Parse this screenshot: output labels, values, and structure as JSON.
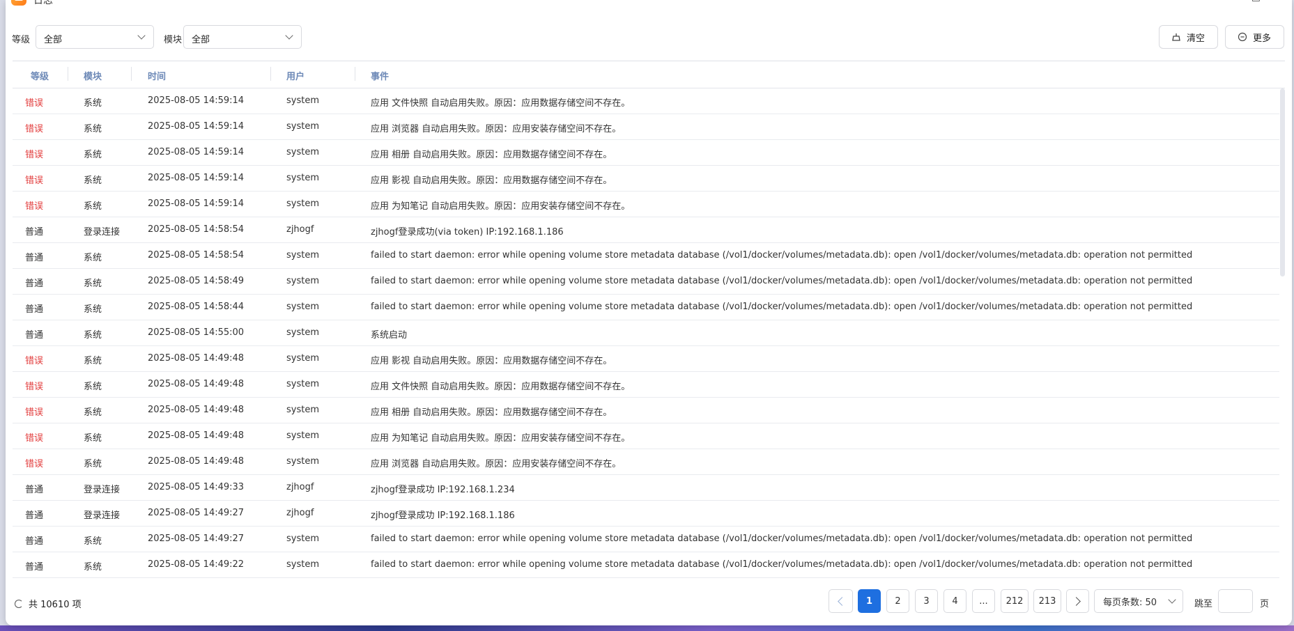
{
  "window": {
    "title": "日志"
  },
  "filters": {
    "level_label": "等级",
    "level_value": "全部",
    "module_label": "模块",
    "module_value": "全部"
  },
  "toolbar": {
    "clear_label": "清空",
    "more_label": "更多"
  },
  "table": {
    "columns": [
      "等级",
      "模块",
      "时间",
      "用户",
      "事件"
    ],
    "rows": [
      {
        "level": "错误",
        "module": "系统",
        "time": "2025-08-05 14:59:14",
        "user": "system",
        "event": "应用 文件快照 自动启用失败。原因：应用数据存储空间不存在。"
      },
      {
        "level": "错误",
        "module": "系统",
        "time": "2025-08-05 14:59:14",
        "user": "system",
        "event": "应用 浏览器 自动启用失败。原因：应用安装存储空间不存在。"
      },
      {
        "level": "错误",
        "module": "系统",
        "time": "2025-08-05 14:59:14",
        "user": "system",
        "event": "应用 相册 自动启用失败。原因：应用数据存储空间不存在。"
      },
      {
        "level": "错误",
        "module": "系统",
        "time": "2025-08-05 14:59:14",
        "user": "system",
        "event": "应用 影视 自动启用失败。原因：应用数据存储空间不存在。"
      },
      {
        "level": "错误",
        "module": "系统",
        "time": "2025-08-05 14:59:14",
        "user": "system",
        "event": "应用 为知笔记 自动启用失败。原因：应用安装存储空间不存在。"
      },
      {
        "level": "普通",
        "module": "登录连接",
        "time": "2025-08-05 14:58:54",
        "user": "zjhogf",
        "event": "zjhogf登录成功(via token) IP:192.168.1.186"
      },
      {
        "level": "普通",
        "module": "系统",
        "time": "2025-08-05 14:58:54",
        "user": "system",
        "event": "failed to start daemon: error while opening volume store metadata database (/vol1/docker/volumes/metadata.db): open /vol1/docker/volumes/metadata.db: operation not permitted"
      },
      {
        "level": "普通",
        "module": "系统",
        "time": "2025-08-05 14:58:49",
        "user": "system",
        "event": "failed to start daemon: error while opening volume store metadata database (/vol1/docker/volumes/metadata.db): open /vol1/docker/volumes/metadata.db: operation not permitted"
      },
      {
        "level": "普通",
        "module": "系统",
        "time": "2025-08-05 14:58:44",
        "user": "system",
        "event": "failed to start daemon: error while opening volume store metadata database (/vol1/docker/volumes/metadata.db): open /vol1/docker/volumes/metadata.db: operation not permitted"
      },
      {
        "level": "普通",
        "module": "系统",
        "time": "2025-08-05 14:55:00",
        "user": "system",
        "event": "系统启动"
      },
      {
        "level": "错误",
        "module": "系统",
        "time": "2025-08-05 14:49:48",
        "user": "system",
        "event": "应用 影视 自动启用失败。原因：应用数据存储空间不存在。"
      },
      {
        "level": "错误",
        "module": "系统",
        "time": "2025-08-05 14:49:48",
        "user": "system",
        "event": "应用 文件快照 自动启用失败。原因：应用数据存储空间不存在。"
      },
      {
        "level": "错误",
        "module": "系统",
        "time": "2025-08-05 14:49:48",
        "user": "system",
        "event": "应用 相册 自动启用失败。原因：应用数据存储空间不存在。"
      },
      {
        "level": "错误",
        "module": "系统",
        "time": "2025-08-05 14:49:48",
        "user": "system",
        "event": "应用 为知笔记 自动启用失败。原因：应用安装存储空间不存在。"
      },
      {
        "level": "错误",
        "module": "系统",
        "time": "2025-08-05 14:49:48",
        "user": "system",
        "event": "应用 浏览器 自动启用失败。原因：应用安装存储空间不存在。"
      },
      {
        "level": "普通",
        "module": "登录连接",
        "time": "2025-08-05 14:49:33",
        "user": "zjhogf",
        "event": "zjhogf登录成功 IP:192.168.1.234"
      },
      {
        "level": "普通",
        "module": "登录连接",
        "time": "2025-08-05 14:49:27",
        "user": "zjhogf",
        "event": "zjhogf登录成功 IP:192.168.1.186"
      },
      {
        "level": "普通",
        "module": "系统",
        "time": "2025-08-05 14:49:27",
        "user": "system",
        "event": "failed to start daemon: error while opening volume store metadata database (/vol1/docker/volumes/metadata.db): open /vol1/docker/volumes/metadata.db: operation not permitted"
      },
      {
        "level": "普通",
        "module": "系统",
        "time": "2025-08-05 14:49:22",
        "user": "system",
        "event": "failed to start daemon: error while opening volume store metadata database (/vol1/docker/volumes/metadata.db): open /vol1/docker/volumes/metadata.db: operation not permitted"
      }
    ]
  },
  "footer": {
    "total_text": "共 10610 项",
    "pages": [
      "1",
      "2",
      "3",
      "4",
      "...",
      "212",
      "213"
    ],
    "current_page": "1",
    "page_size_label": "每页条数: 50",
    "jump_label": "跳至",
    "page_suffix": "页"
  },
  "colors": {
    "error": "#e23a3a",
    "accent": "#1e6fe0",
    "header_text": "#6d89b7"
  }
}
